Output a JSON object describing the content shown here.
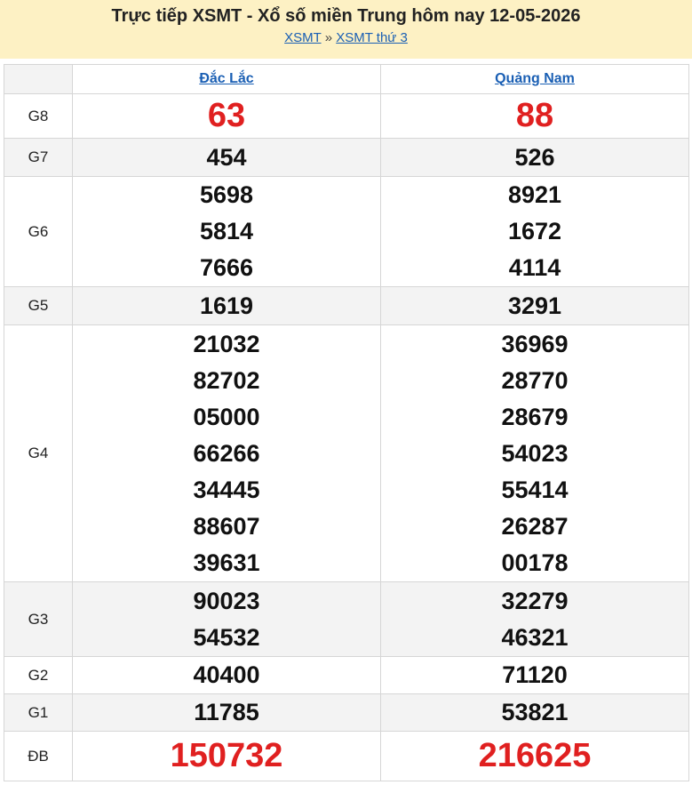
{
  "header": {
    "title": "Trực tiếp XSMT - Xổ số miền Trung hôm nay 12-05-2026",
    "crumb_home": "XSMT",
    "crumb_sep": "»",
    "crumb_day": "XSMT thứ 3"
  },
  "provinces": [
    "Đắc Lắc",
    "Quảng Nam"
  ],
  "prizes": [
    {
      "label": "G8",
      "left": [
        "63"
      ],
      "right": [
        "88"
      ],
      "big": true
    },
    {
      "label": "G7",
      "left": [
        "454"
      ],
      "right": [
        "526"
      ]
    },
    {
      "label": "G6",
      "left": [
        "5698",
        "5814",
        "7666"
      ],
      "right": [
        "8921",
        "1672",
        "4114"
      ]
    },
    {
      "label": "G5",
      "left": [
        "1619"
      ],
      "right": [
        "3291"
      ]
    },
    {
      "label": "G4",
      "left": [
        "21032",
        "82702",
        "05000",
        "66266",
        "34445",
        "88607",
        "39631"
      ],
      "right": [
        "36969",
        "28770",
        "28679",
        "54023",
        "55414",
        "26287",
        "00178"
      ]
    },
    {
      "label": "G3",
      "left": [
        "90023",
        "54532"
      ],
      "right": [
        "32279",
        "46321"
      ]
    },
    {
      "label": "G2",
      "left": [
        "40400"
      ],
      "right": [
        "71120"
      ]
    },
    {
      "label": "G1",
      "left": [
        "11785"
      ],
      "right": [
        "53821"
      ]
    },
    {
      "label": "ĐB",
      "left": [
        "150732"
      ],
      "right": [
        "216625"
      ],
      "big": true
    }
  ],
  "colors": {
    "accent_red": "#e02020",
    "header_bg": "#fdf1c4",
    "link": "#1a5fb4"
  }
}
